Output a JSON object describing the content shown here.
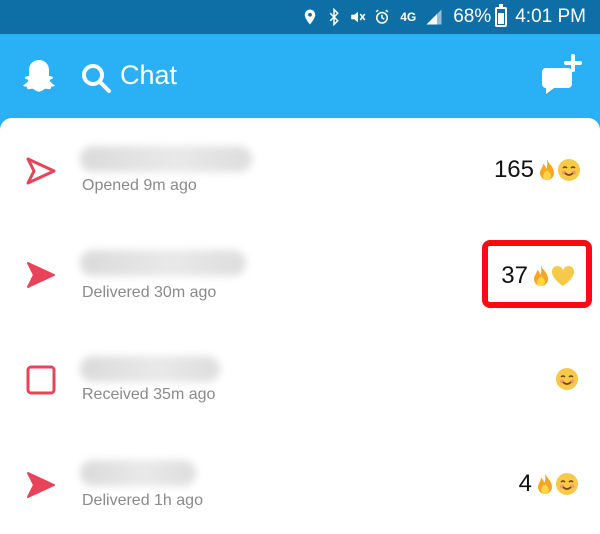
{
  "status_bar": {
    "network": "4G",
    "battery": "68%",
    "time": "4:01 PM",
    "icons": [
      "location-icon",
      "bluetooth-icon",
      "mute-icon",
      "alarm-icon",
      "network-4g-icon",
      "signal-icon",
      "battery-icon"
    ]
  },
  "header": {
    "title": "Chat",
    "icons": [
      "ghost-icon",
      "search-icon",
      "new-chat-icon"
    ]
  },
  "chats": [
    {
      "status": "Opened 9m ago",
      "status_icon": "opened-arrow-icon",
      "streak_count": "165",
      "emojis": [
        "fire-icon",
        "smiling-face-icon"
      ]
    },
    {
      "status": "Delivered 30m ago",
      "status_icon": "delivered-arrow-icon",
      "streak_count": "37",
      "emojis": [
        "fire-icon",
        "yellow-heart-icon"
      ]
    },
    {
      "status": "Received 35m ago",
      "status_icon": "received-square-icon",
      "streak_count": "",
      "emojis": [
        "smiling-face-icon"
      ]
    },
    {
      "status": "Delivered 1h ago",
      "status_icon": "delivered-arrow-icon",
      "streak_count": "4",
      "emojis": [
        "fire-icon",
        "smiling-face-icon"
      ]
    }
  ],
  "colors": {
    "status_bar": "#0e6fa6",
    "header": "#2ab0f5",
    "accent_red": "#e8435b",
    "highlight": "#ff0a14"
  }
}
